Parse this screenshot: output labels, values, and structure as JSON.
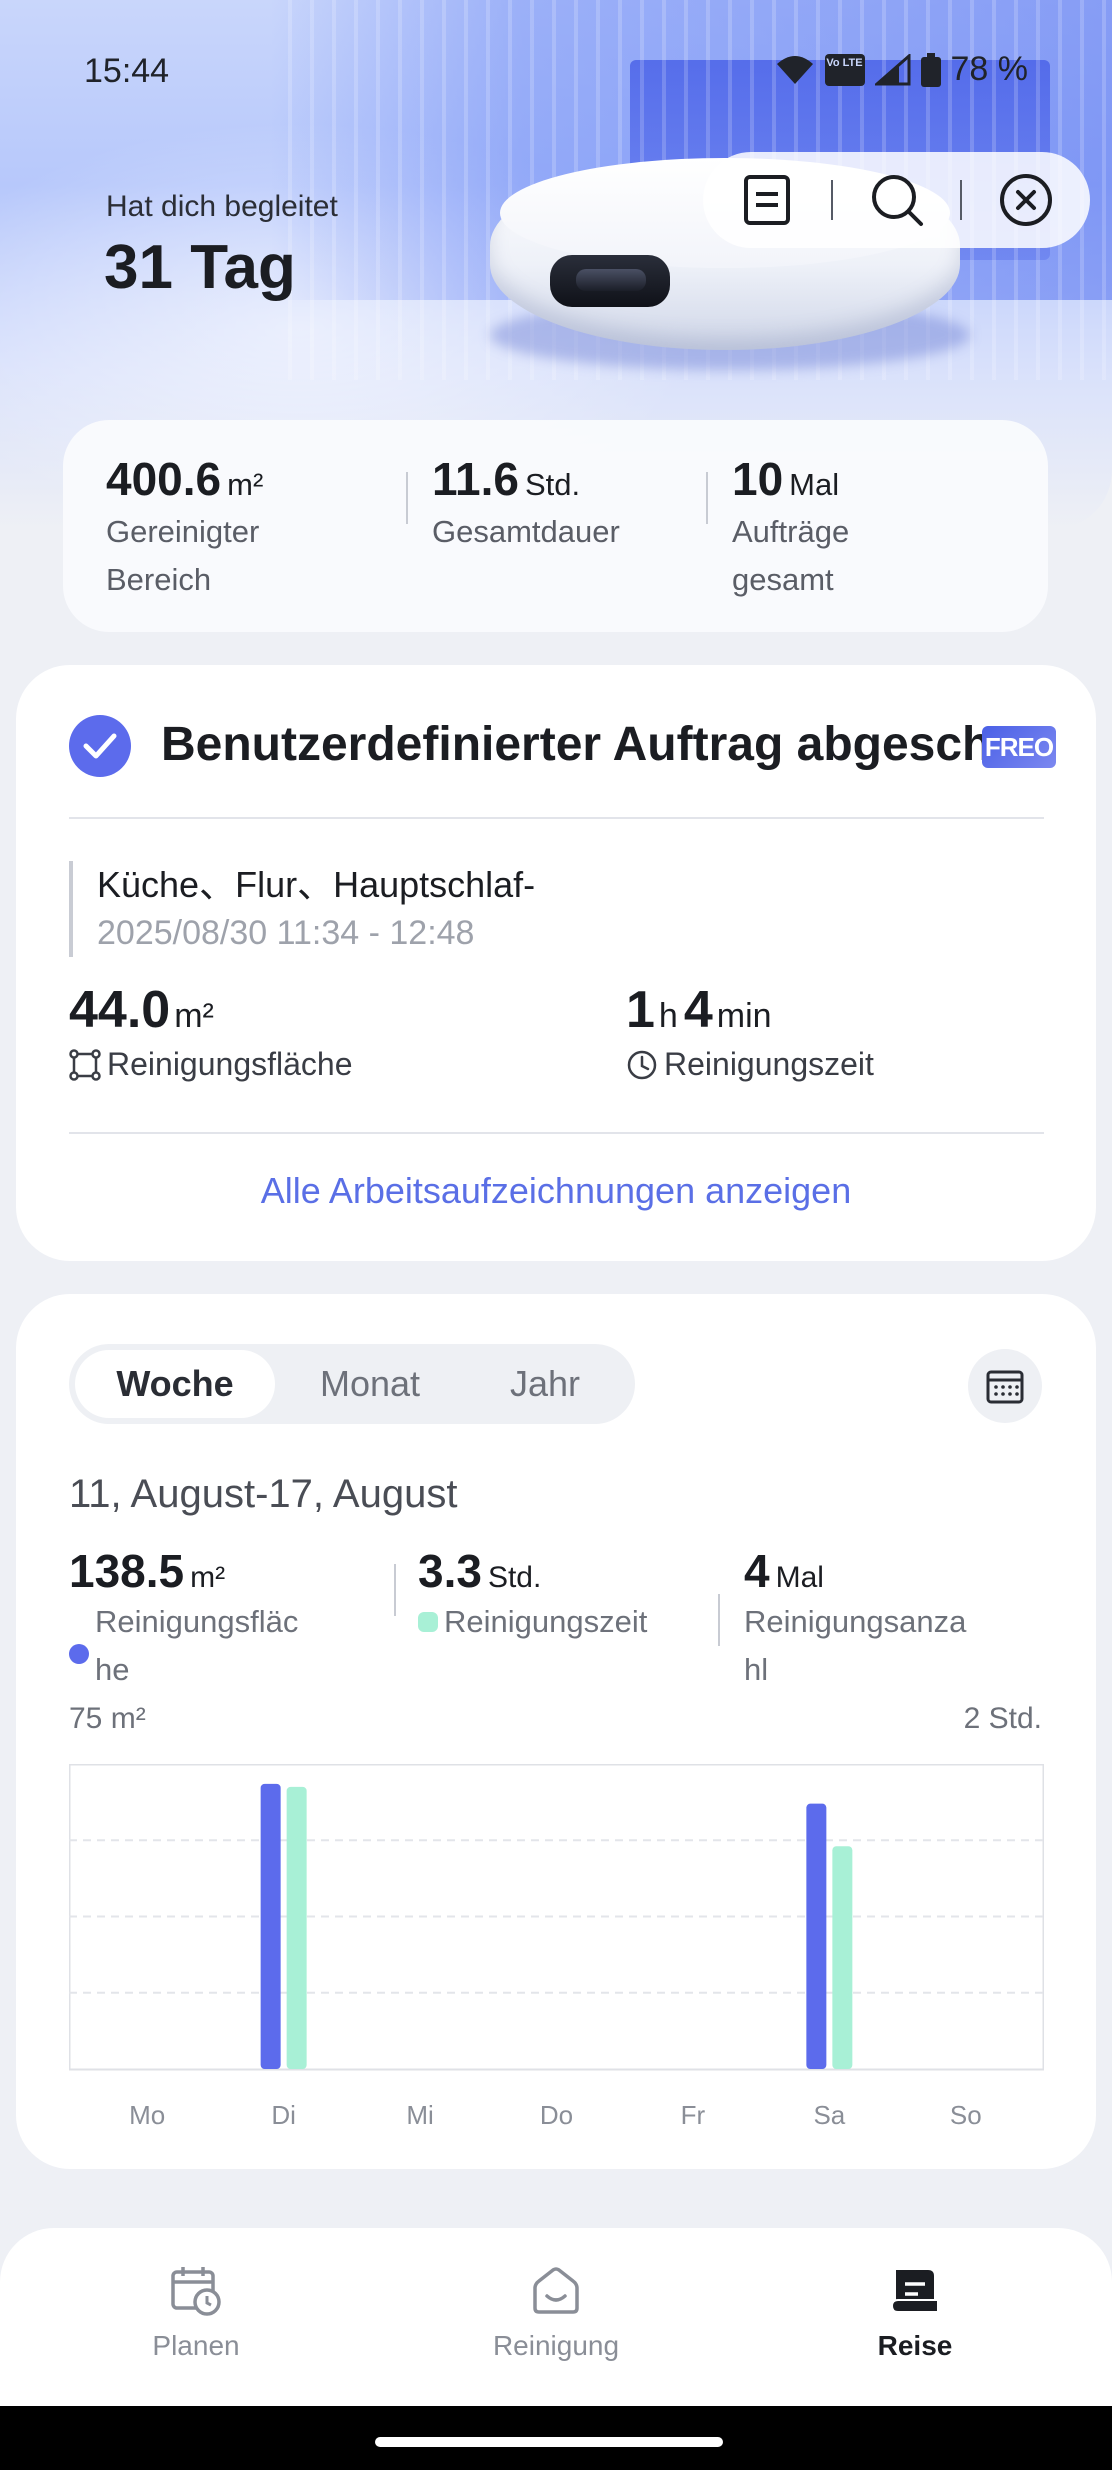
{
  "status_bar": {
    "time": "15:44",
    "battery": "78 %",
    "volte": "Vo LTE"
  },
  "hero": {
    "subtitle": "Hat dich begleitet",
    "title": "31 Tag"
  },
  "header_actions": {
    "icons": [
      "document-icon",
      "search-icon",
      "close-icon"
    ]
  },
  "summary": {
    "area": {
      "value": "400.6",
      "unit": "m²",
      "label": "Gereinigter Bereich"
    },
    "duration": {
      "value": "11.6",
      "unit": "Std.",
      "label": "Gesamtdauer"
    },
    "jobs": {
      "value": "10",
      "unit": "Mal",
      "label": "Aufträge gesamt"
    }
  },
  "last_task": {
    "title": "Benutzerdefinierter Auftrag abgeschlossen",
    "badge": "FREO",
    "rooms": "Küche、Flur、Hauptschlaf-",
    "datetime": "2025/08/30 11:34 - 12:48",
    "area_value": "44.0",
    "area_unit": "m²",
    "area_label": "Reinigungsfläche",
    "time_h": "1",
    "time_h_unit": "h",
    "time_m": "4",
    "time_m_unit": "min",
    "time_label": "Reinigungszeit",
    "link": "Alle Arbeitsaufzeichnungen anzeigen"
  },
  "stats": {
    "tabs": [
      {
        "label": "Woche",
        "active": true
      },
      {
        "label": "Monat",
        "active": false
      },
      {
        "label": "Jahr",
        "active": false
      }
    ],
    "range": "11, August-17, August",
    "area": {
      "value": "138.5",
      "unit": "m²",
      "label": "Reinigungsfläche",
      "color": "#5c6bec"
    },
    "time": {
      "value": "3.3",
      "unit": "Std.",
      "label": "Reinigungszeit",
      "color": "#a8f0d6"
    },
    "count": {
      "value": "4",
      "unit": "Mal",
      "label": "Reinigungsanzahl"
    },
    "axis_left": "75 m²",
    "axis_right": "2 Std."
  },
  "chart_data": {
    "type": "bar",
    "categories": [
      "Mo",
      "Di",
      "Mi",
      "Do",
      "Fr",
      "Sa",
      "So"
    ],
    "series": [
      {
        "name": "Reinigungsfläche",
        "unit": "m²",
        "color": "#5c6bec",
        "values": [
          0,
          72,
          0,
          0,
          0,
          67,
          0
        ]
      },
      {
        "name": "Reinigungszeit",
        "unit": "Std.",
        "color": "#a8f0d6",
        "values": [
          0,
          1.9,
          0,
          0,
          0,
          1.5,
          0
        ]
      }
    ],
    "ylim_left": [
      0,
      75
    ],
    "ylim_right": [
      0,
      2
    ],
    "grid": true
  },
  "bottom_nav": [
    {
      "label": "Planen",
      "icon": "calendar-clock-icon",
      "active": false
    },
    {
      "label": "Reinigung",
      "icon": "home-icon",
      "active": false
    },
    {
      "label": "Reise",
      "icon": "journey-icon",
      "active": true
    }
  ]
}
